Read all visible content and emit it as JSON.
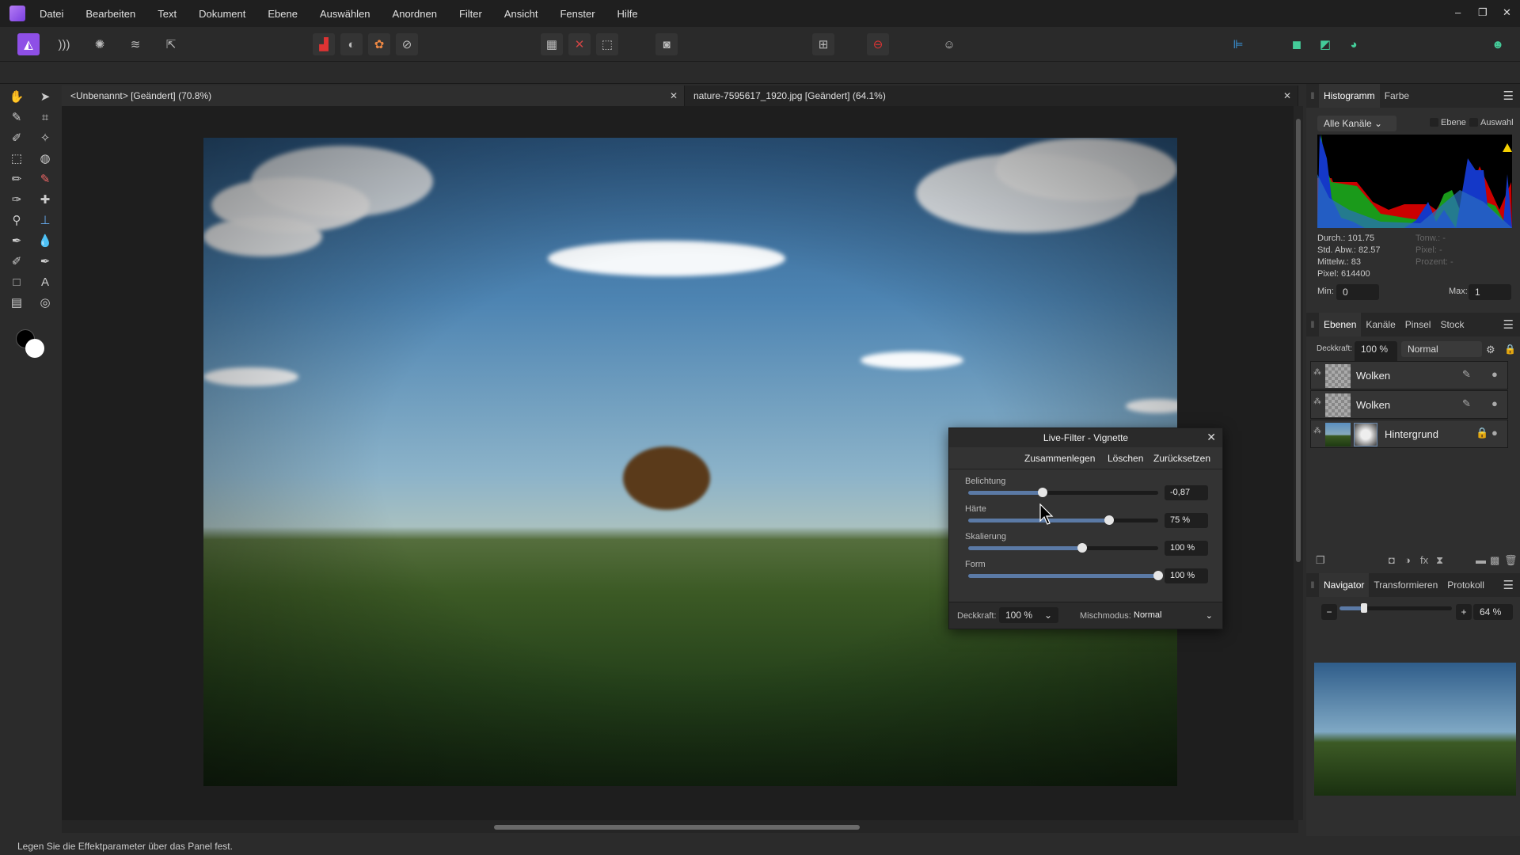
{
  "menu": [
    "Datei",
    "Bearbeiten",
    "Text",
    "Dokument",
    "Ebene",
    "Auswählen",
    "Anordnen",
    "Filter",
    "Ansicht",
    "Fenster",
    "Hilfe"
  ],
  "window_controls": {
    "minimize": "–",
    "restore": "❐",
    "close": "✕"
  },
  "colors": {
    "accent": "#8e4fe6",
    "slider_fill": "#5b7aa6",
    "warning": "#f5d000"
  },
  "tabs": [
    {
      "label": "<Unbenannt> [Geändert] (70.8%)"
    },
    {
      "label": "nature-7595617_1920.jpg [Geändert] (64.1%)"
    }
  ],
  "status": "Legen Sie die Effektparameter über das Panel fest.",
  "histogram": {
    "tabs": [
      "Histogramm",
      "Farbe"
    ],
    "channel": "Alle Kanäle",
    "checks": [
      "Ebene",
      "Auswahl"
    ],
    "stats": [
      "Durch.: 101.75",
      "Std. Abw.: 82.57",
      "Mittelw.: 83",
      "Pixel: 614400"
    ],
    "stats_right": [
      "Tonw.: -",
      "Pixel: -",
      "Prozent: -"
    ],
    "min_label": "Min:",
    "min": "0",
    "max_label": "Max:",
    "max": "1"
  },
  "layers": {
    "tabs": [
      "Ebenen",
      "Kanäle",
      "Pinsel",
      "Stock"
    ],
    "opacity_label": "Deckkraft:",
    "opacity": "100 %",
    "blend": "Normal",
    "items": [
      {
        "name": "Wolken"
      },
      {
        "name": "Wolken"
      },
      {
        "name": "Hintergrund"
      }
    ]
  },
  "navigator": {
    "tabs": [
      "Navigator",
      "Transformieren",
      "Protokoll"
    ],
    "zoom": "64 %",
    "zoom_level": 0.22
  },
  "dialog": {
    "title": "Live-Filter - Vignette",
    "buttons": [
      "Zusammenlegen",
      "Löschen",
      "Zurücksetzen"
    ],
    "sliders": [
      {
        "label": "Belichtung",
        "value": "-0,87",
        "level": 0.39
      },
      {
        "label": "Härte",
        "value": "75 %",
        "level": 0.74
      },
      {
        "label": "Skalierung",
        "value": "100 %",
        "level": 0.6
      },
      {
        "label": "Form",
        "value": "100 %",
        "level": 1.0
      }
    ],
    "opacity_label": "Deckkraft:",
    "opacity": "100 %",
    "blend_label": "Mischmodus:",
    "blend": "Normal"
  }
}
